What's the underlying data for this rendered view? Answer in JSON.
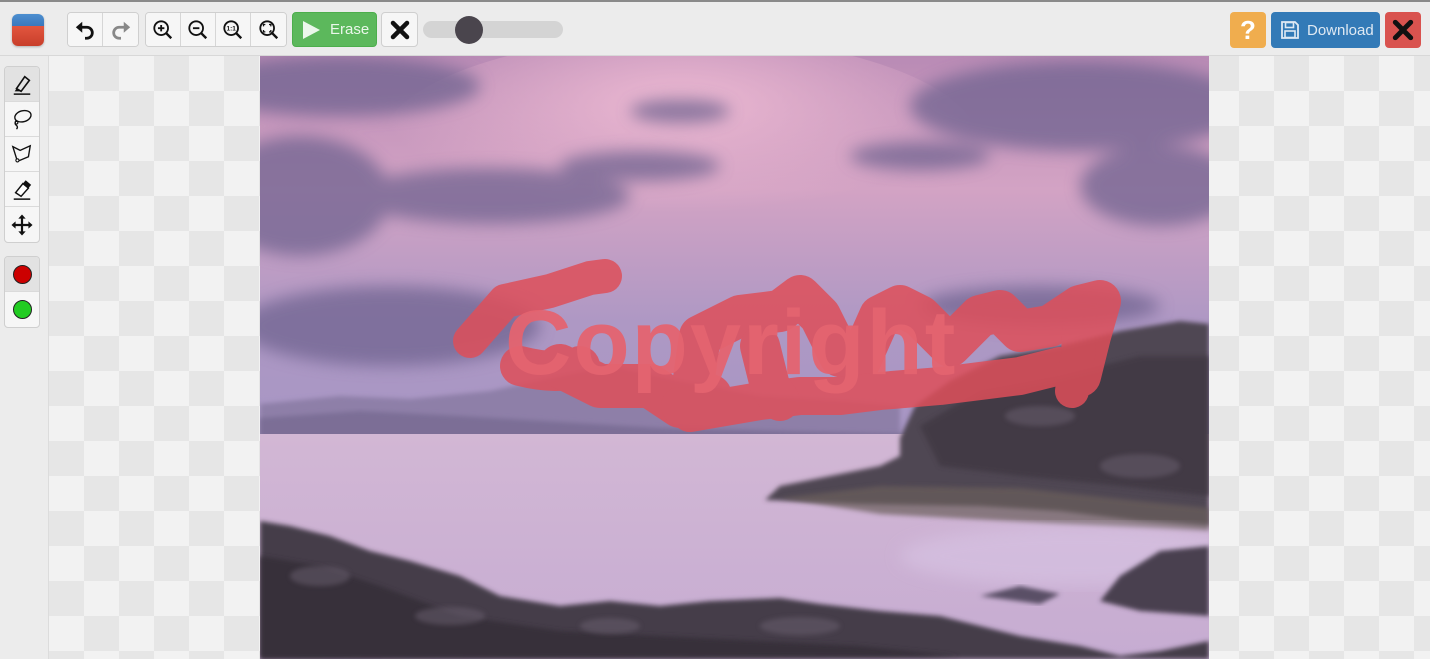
{
  "app": {
    "logo_icon": "app-logo-icon"
  },
  "toolbar": {
    "history": [
      {
        "name": "undo",
        "icon": "undo-icon",
        "label": "Undo"
      },
      {
        "name": "redo",
        "icon": "redo-icon",
        "label": "Redo"
      }
    ],
    "zoom": [
      {
        "name": "zoom-in",
        "icon": "zoom-in-icon",
        "label": "Zoom in"
      },
      {
        "name": "zoom-out",
        "icon": "zoom-out-icon",
        "label": "Zoom out"
      },
      {
        "name": "zoom-actual",
        "icon": "zoom-actual-size-icon",
        "label": "1:1",
        "glyph": "1:1"
      },
      {
        "name": "zoom-fit",
        "icon": "zoom-fit-icon",
        "label": "Fit"
      }
    ],
    "erase_label": "Erase",
    "clear_icon": "close-icon",
    "brush_size_fraction": 0.33,
    "help_label": "?",
    "download_label": "Download",
    "exit_icon": "close-icon"
  },
  "tools": {
    "items": [
      {
        "name": "marker",
        "icon": "marker-icon",
        "active": true
      },
      {
        "name": "lasso",
        "icon": "lasso-icon",
        "active": false
      },
      {
        "name": "polygon-lasso",
        "icon": "polygon-lasso-icon",
        "active": false
      },
      {
        "name": "eraser",
        "icon": "eraser-icon",
        "active": false
      },
      {
        "name": "move",
        "icon": "move-icon",
        "active": false
      }
    ],
    "colors": [
      {
        "name": "red",
        "value": "#cc0000",
        "active": true
      },
      {
        "name": "green",
        "value": "#22cc22",
        "active": false
      }
    ]
  },
  "canvas": {
    "watermark_text": "Copyright",
    "mask_color": "#e0545f",
    "image_description": "purple-pink seascape with rocky coast"
  },
  "colors": {
    "erase_green": "#5cb85c",
    "download_blue": "#337ab7",
    "help_orange": "#f0ad4e",
    "close_red": "#d9534f"
  }
}
